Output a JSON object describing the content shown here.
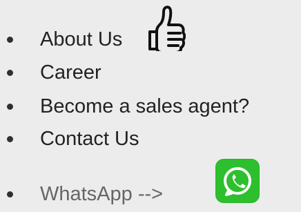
{
  "menu": {
    "items": [
      {
        "label": "About Us"
      },
      {
        "label": "Career"
      },
      {
        "label": "Become a sales agent?"
      },
      {
        "label": "Contact Us"
      },
      {
        "label": "WhatsApp -->"
      }
    ]
  },
  "icons": {
    "thumb": "thumbs-up-icon",
    "whatsapp": "whatsapp-icon"
  },
  "colors": {
    "background": "#ececec",
    "text": "#222222",
    "muted_text": "#666666",
    "whatsapp_green": "#2dbf2d"
  }
}
